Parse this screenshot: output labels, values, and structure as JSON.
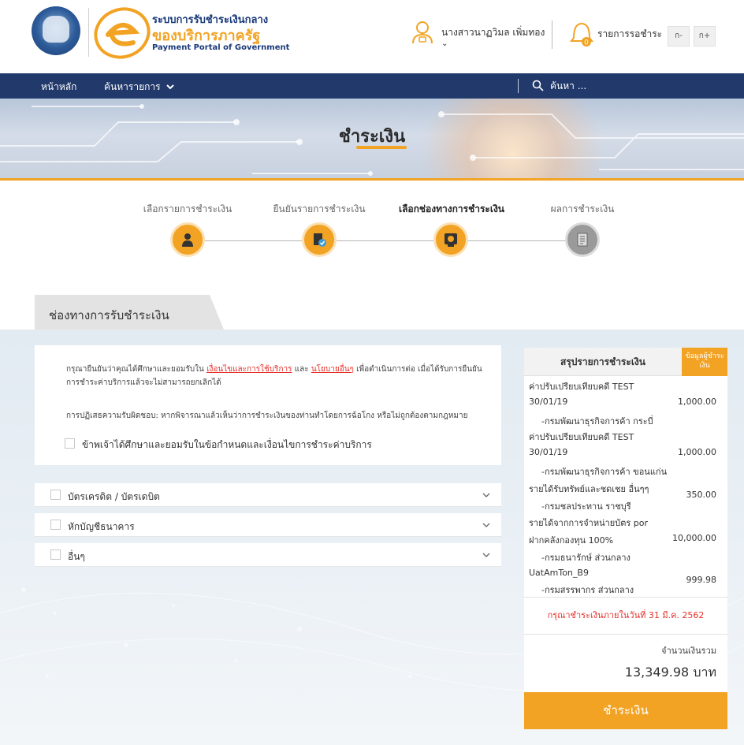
{
  "header": {
    "brand_line1": "ระบบการรับชำระเงินกลาง",
    "brand_line2": "ของบริการภาครัฐ",
    "brand_line3": "Payment Portal of Government",
    "user_name": "นางสาวนาฏวิมล เพิ่มทอง",
    "user_caret": "⌄",
    "pending_label": "รายการรอชำระ",
    "pending_count": "0",
    "font_smaller": "ก-",
    "font_larger": "ก+"
  },
  "nav": {
    "home": "หน้าหลัก",
    "search_list": "ค้นหารายการ",
    "search_placeholder": "ค้นหา ..."
  },
  "banner": {
    "title": "ชำระเงิน"
  },
  "steps": [
    {
      "label": "เลือกรายการชำระเงิน",
      "icon": "person-icon"
    },
    {
      "label": "ยืนยันรายการชำระเงิน",
      "icon": "document-check-icon"
    },
    {
      "label": "เลือกช่องทางการชำระเงิน",
      "icon": "payment-channel-icon"
    },
    {
      "label": "ผลการชำระเงิน",
      "icon": "receipt-icon"
    }
  ],
  "section": {
    "title": "ช่องทางการรับชำระเงิน"
  },
  "terms": {
    "text_before": "กรุณายืนยันว่าคุณได้ศึกษาและยอมรับใน ",
    "link_terms": "เงื่อนไขและการใช้บริการ",
    "text_and": " และ ",
    "link_policy": "นโยบายอื่นๆ",
    "text_after": " เพื่อดำเนินการต่อ เมื่อได้รับการยืนยันการชำระค่าบริการแล้วจะไม่สามารถยกเลิกได้",
    "disclaimer": "การปฏิเสธความรับผิดชอบ: หากพิจารณาแล้วเห็นว่าการชำระเงินของท่านทำโดยการฉ้อโกง หรือไม่ถูกต้องตามกฎหมาย",
    "accept_label": "ข้าพเจ้าได้ศึกษาและยอมรับในข้อกำหนดและเงื่อนไขการชำระค่าบริการ"
  },
  "payment_methods": [
    {
      "label": "บัตรเครดิต / บัตรเดบิต"
    },
    {
      "label": "หักบัญชีธนาคาร"
    },
    {
      "label": "อื่นๆ"
    }
  ],
  "summary": {
    "header": "สรุปรายการชำระเงิน",
    "badge": "ข้อมูลผู้ชำระเงิน",
    "items": [
      {
        "line1": "ค่าปรับเปรียบเทียบคดี TEST",
        "line2": "30/01/19",
        "amount": "1,000.00",
        "line3": "-กรมพัฒนาธุรกิจการค้า กระบี่"
      },
      {
        "line1": "ค่าปรับเปรียบเทียบคดี TEST",
        "line2": "30/01/19",
        "amount": "1,000.00",
        "line3": "-กรมพัฒนาธุรกิจการค้า ขอนแก่น"
      },
      {
        "line1": "รายได้รับทรัพย์และชดเชย อื่นๆๆ",
        "amount": "350.00",
        "line3": "-กรมชลประทาน ราชบุรี"
      },
      {
        "line1": "รายได้จากการจำหน่ายบัตร por",
        "line2": "ฝากคลังกองทุน 100%",
        "amount": "10,000.00",
        "line3": "-กรมธนารักษ์ ส่วนกลาง"
      },
      {
        "line1": "UatAmTon_B9",
        "amount": "999.98",
        "line3": "-กรมสรรพากร ส่วนกลาง"
      }
    ],
    "due_note": "กรุณาชำระเงินภายในวันที่ 31 มี.ค. 2562",
    "total_label": "จำนวนเงินรวม",
    "total_value": "13,349.98 บาท",
    "pay_button": "ชำระเงิน"
  },
  "colors": {
    "accent": "#f2a324",
    "navy": "#22396b",
    "link": "#e4312b"
  }
}
